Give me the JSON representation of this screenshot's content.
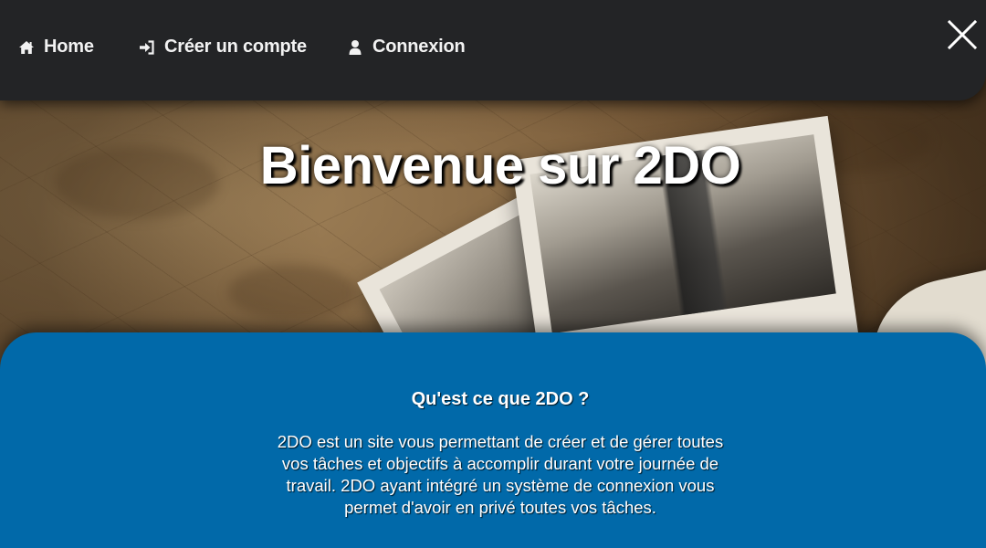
{
  "nav": {
    "items": [
      {
        "label": "Home",
        "icon": "home-icon"
      },
      {
        "label": "Créer un compte",
        "icon": "sign-in-icon"
      },
      {
        "label": "Connexion",
        "icon": "user-icon"
      }
    ],
    "close_icon": "close-icon"
  },
  "hero": {
    "title": "Bienvenue sur 2DO"
  },
  "info": {
    "title": "Qu'est ce que 2DO ?",
    "text": "2DO est un site vous permettant de créer et de gérer toutes vos tâches et objectifs à accomplir durant votre journée de travail. 2DO ayant intégré un système de connexion vous permet d'avoir en privé toutes vos tâches."
  },
  "colors": {
    "navbar": "#232426",
    "info_panel": "#0169a9",
    "text": "#ffffff"
  }
}
